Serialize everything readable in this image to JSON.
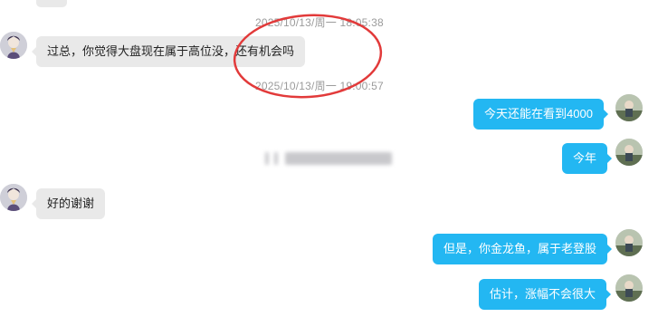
{
  "messages": [
    {
      "kind": "timestamp",
      "text": "2025/10/13/周一 18:05:38"
    },
    {
      "kind": "incoming",
      "text": "过总，你觉得大盘现在属于高位没，还有机会吗"
    },
    {
      "kind": "timestamp",
      "text": "2025/10/13/周一 19:00:57"
    },
    {
      "kind": "outgoing",
      "text": "今天还能在看到4000"
    },
    {
      "kind": "outgoing",
      "text": "今年"
    },
    {
      "kind": "incoming",
      "text": "好的谢谢"
    },
    {
      "kind": "outgoing",
      "text": "但是，你金龙鱼，属于老登股"
    },
    {
      "kind": "outgoing",
      "text": "估计，涨幅不会很大"
    }
  ],
  "colors": {
    "outgoing_bubble": "#23b7f2",
    "incoming_bubble": "#e9e9e9",
    "timestamp": "#9b9b9b",
    "annotation_circle": "#e23a3a"
  }
}
